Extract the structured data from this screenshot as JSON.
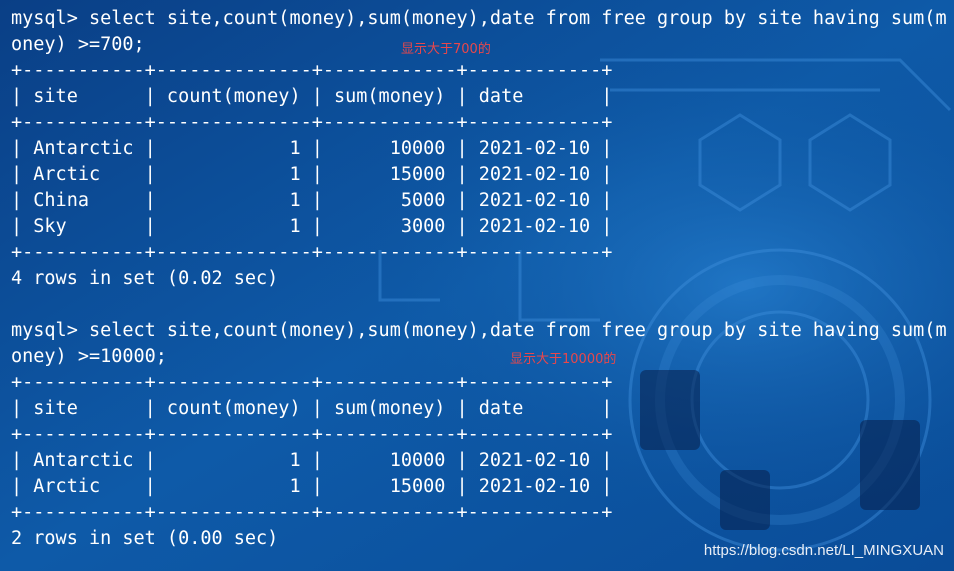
{
  "terminal": {
    "blocks": [
      {
        "command_lines": [
          "mysql> select site,count(money),sum(money),date from free group by site having sum(m",
          "oney) >=700;"
        ],
        "annotation": "显示大于700的",
        "separator": "+-----------+--------------+------------+------------+",
        "header": "| site      | count(money) | sum(money) | date       |",
        "rows": [
          "| Antarctic |            1 |      10000 | 2021-02-10 |",
          "| Arctic    |            1 |      15000 | 2021-02-10 |",
          "| China     |            1 |       5000 | 2021-02-10 |",
          "| Sky       |            1 |       3000 | 2021-02-10 |"
        ],
        "result": "4 rows in set (0.02 sec)"
      },
      {
        "command_lines": [
          "mysql> select site,count(money),sum(money),date from free group by site having sum(m",
          "oney) >=10000;"
        ],
        "annotation": "显示大于10000的",
        "separator": "+-----------+--------------+------------+------------+",
        "header": "| site      | count(money) | sum(money) | date       |",
        "rows": [
          "| Antarctic |            1 |      10000 | 2021-02-10 |",
          "| Arctic    |            1 |      15000 | 2021-02-10 |"
        ],
        "result": "2 rows in set (0.00 sec)"
      }
    ]
  },
  "watermark": "https://blog.csdn.net/LI_MINGXUAN",
  "colors": {
    "background": "#0b4f96",
    "text": "#ffffff",
    "annotation": "#e8474b"
  }
}
